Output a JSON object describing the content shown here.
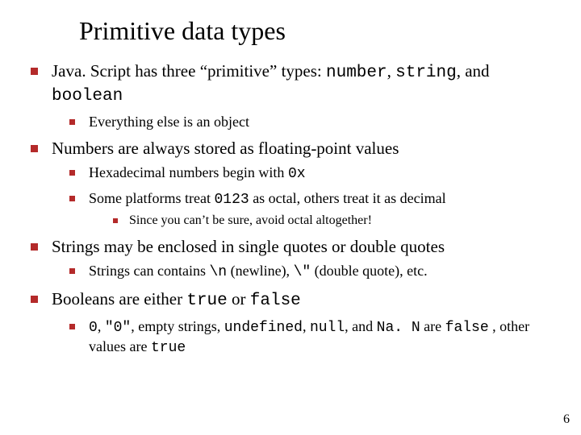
{
  "title": "Primitive data types",
  "b1": {
    "pre": "Java. Script has three “primitive” types: ",
    "c1": "number",
    "sep1": ", ",
    "c2": "string",
    "sep2": ", and ",
    "c3": "boolean",
    "sub1": "Everything else is an object"
  },
  "b2": {
    "text": "Numbers are always stored as floating-point values",
    "sub1_pre": "Hexadecimal numbers begin with ",
    "sub1_code": "0x",
    "sub2_pre": "Some platforms treat ",
    "sub2_code": "0123",
    "sub2_post": " as octal, others treat it as decimal",
    "sub2a": "Since you can’t be sure, avoid octal altogether!"
  },
  "b3": {
    "text": "Strings may be enclosed in single quotes or double quotes",
    "sub1_pre": "Strings can contains ",
    "sub1_c1": "\\n",
    "sub1_mid1": " (newline), ",
    "sub1_c2": "\\\"",
    "sub1_post": " (double quote), etc."
  },
  "b4": {
    "pre": "Booleans are either ",
    "c1": "true",
    "mid": " or ",
    "c2": "false",
    "sub1_c1": "0",
    "sub1_s1": ", ",
    "sub1_c2": "\"0\"",
    "sub1_s2": ", empty strings, ",
    "sub1_c3": "undefined",
    "sub1_s3": ", ",
    "sub1_c4": "null",
    "sub1_s4": ", and ",
    "sub1_c5": "Na. N",
    "sub1_s5": " are ",
    "sub1_c6": "false",
    "sub1_s6": " , other values are ",
    "sub1_c7": "true"
  },
  "page_number": "6"
}
